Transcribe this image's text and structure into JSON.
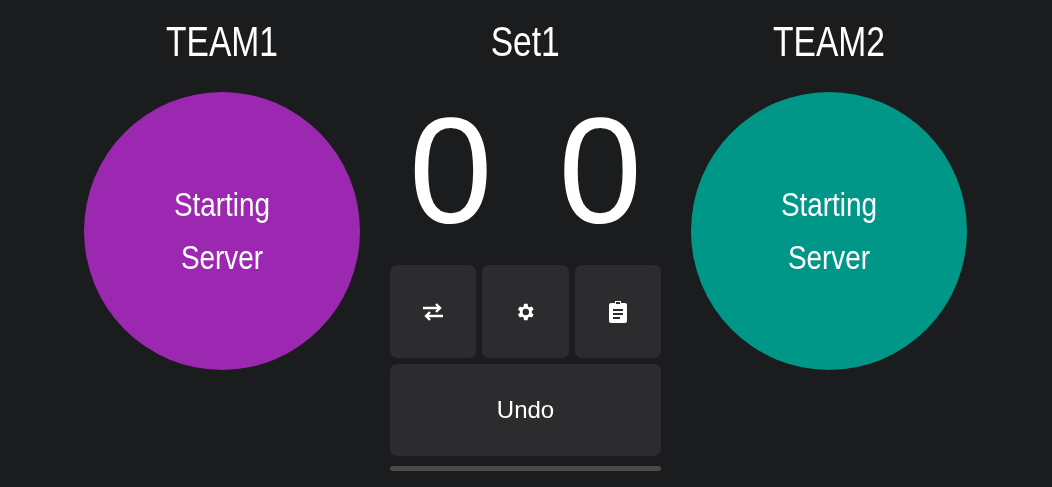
{
  "set_label": "Set1",
  "teams": [
    {
      "name": "TEAM1",
      "color": "#9c27b0",
      "serve_label": "Starting Server",
      "score": "0"
    },
    {
      "name": "TEAM2",
      "color": "#009688",
      "serve_label": "Starting Server",
      "score": "0"
    }
  ],
  "actions": [
    {
      "kind": "swap"
    },
    {
      "kind": "settings"
    },
    {
      "kind": "clipboard"
    }
  ],
  "undo": {
    "label": "Undo"
  }
}
